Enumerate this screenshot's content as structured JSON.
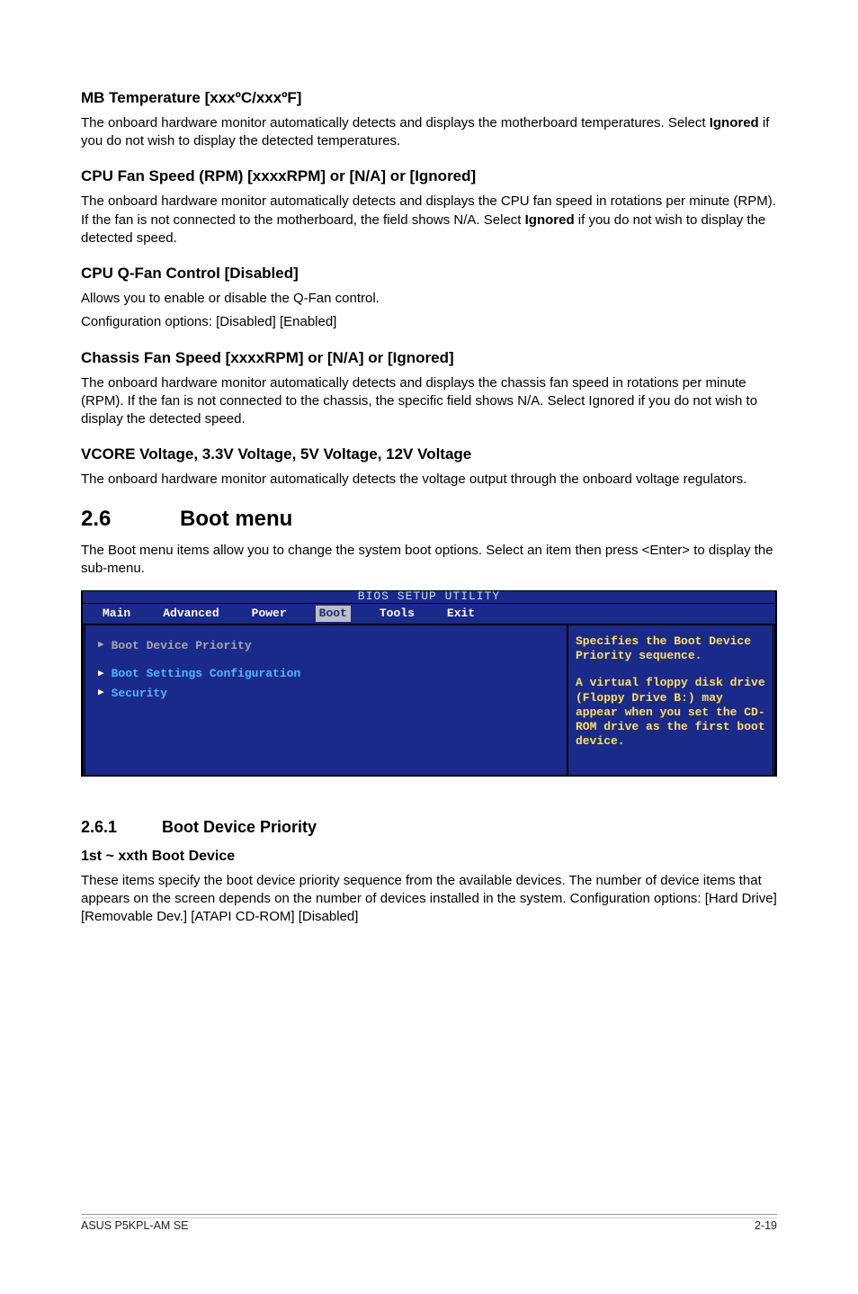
{
  "sections": {
    "mb_temp": {
      "title": "MB Temperature [xxxºC/xxxºF]",
      "body_a": "The onboard hardware monitor automatically detects and displays the motherboard temperatures. Select ",
      "body_bold": "Ignored",
      "body_b": " if you do not wish to display the detected temperatures."
    },
    "cpu_fan": {
      "title": "CPU Fan Speed (RPM) [xxxxRPM] or [N/A] or [Ignored]",
      "body_a": "The onboard hardware monitor automatically detects and displays the CPU fan speed in rotations per minute (RPM). If the fan is not connected to the motherboard, the field shows N/A. Select ",
      "body_bold": "Ignored",
      "body_b": " if you do not wish to display the detected speed."
    },
    "qfan": {
      "title": "CPU Q-Fan Control [Disabled]",
      "line1": "Allows you to enable or disable the Q-Fan control.",
      "line2": "Configuration options: [Disabled] [Enabled]"
    },
    "chassis": {
      "title": "Chassis Fan Speed [xxxxRPM] or [N/A] or [Ignored]",
      "body": "The onboard hardware monitor automatically detects and displays the chassis fan speed in rotations per minute (RPM). If the fan is not connected to the chassis, the specific field shows N/A. Select Ignored if you do not wish to display the detected speed."
    },
    "vcore": {
      "title": "VCORE Voltage, 3.3V Voltage, 5V Voltage, 12V Voltage",
      "body": "The onboard hardware monitor automatically detects the voltage output through the onboard voltage regulators."
    },
    "boot_menu": {
      "num": "2.6",
      "title": "Boot menu",
      "body": "The Boot menu items allow you to change the system boot options. Select an item then press <Enter> to display the sub-menu."
    },
    "boot_priority": {
      "num": "2.6.1",
      "title": "Boot Device Priority",
      "sub": "1st ~ xxth Boot Device",
      "body": "These items specify the boot device priority sequence from the available devices. The number of device items that appears on the screen depends on the number of devices installed in the system. Configuration options: [Hard Drive] [Removable Dev.] [ATAPI CD-ROM] [Disabled]"
    }
  },
  "bios": {
    "title": "BIOS SETUP UTILITY",
    "tabs": {
      "main": "Main",
      "advanced": "Advanced",
      "power": "Power",
      "boot": "Boot",
      "tools": "Tools",
      "exit": "Exit"
    },
    "left": {
      "item1": "Boot Device Priority",
      "item2": "Boot Settings Configuration",
      "item3": "Security"
    },
    "right": {
      "p1": "Specifies the Boot Device Priority sequence.",
      "p2": "A virtual floppy disk drive (Floppy Drive B:) may appear when you set the CD-ROM drive as the first boot device."
    }
  },
  "footer": {
    "left": "ASUS P5KPL-AM SE",
    "right": "2-19"
  }
}
